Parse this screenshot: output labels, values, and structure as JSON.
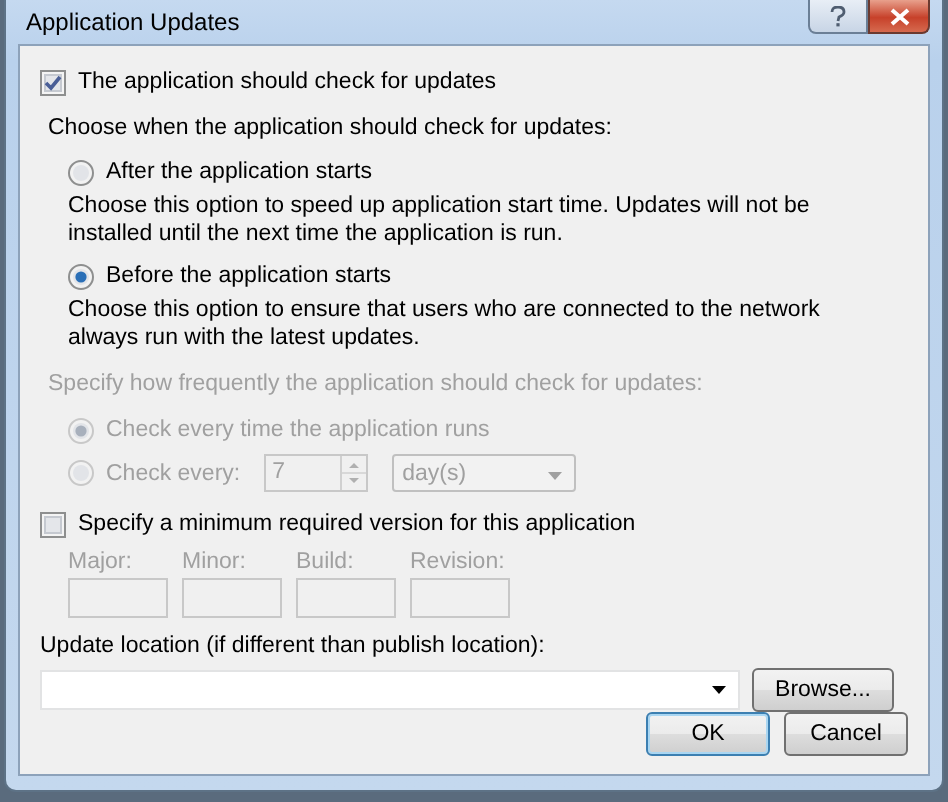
{
  "window": {
    "title": "Application Updates"
  },
  "check_updates": {
    "label": "The application should check for updates",
    "checked": true
  },
  "when": {
    "label": "Choose when the application should check for updates:",
    "options": [
      {
        "label": "After the application starts",
        "description": "Choose this option to speed up application start time. Updates will not be installed until the next time the application is run.",
        "selected": false
      },
      {
        "label": "Before the application starts",
        "description": "Choose this option to ensure that users who are connected to the network always run with the latest updates.",
        "selected": true
      }
    ]
  },
  "frequency": {
    "label": "Specify how frequently the application should check for updates:",
    "disabled": true,
    "options": [
      {
        "kind": "plain",
        "label": "Check every time the application runs",
        "selected": true
      },
      {
        "kind": "interval",
        "label": "Check every:",
        "selected": false,
        "value": "7",
        "unit": "day(s)"
      }
    ]
  },
  "minimum_version": {
    "label": "Specify a minimum required version for this application",
    "checked": false,
    "fields": [
      {
        "label": "Major:"
      },
      {
        "label": "Minor:"
      },
      {
        "label": "Build:"
      },
      {
        "label": "Revision:"
      }
    ]
  },
  "update_location": {
    "label": "Update location (if different than publish location):",
    "button": "Browse..."
  },
  "buttons": [
    {
      "label": "OK",
      "default": true
    },
    {
      "label": "Cancel",
      "default": false
    }
  ]
}
